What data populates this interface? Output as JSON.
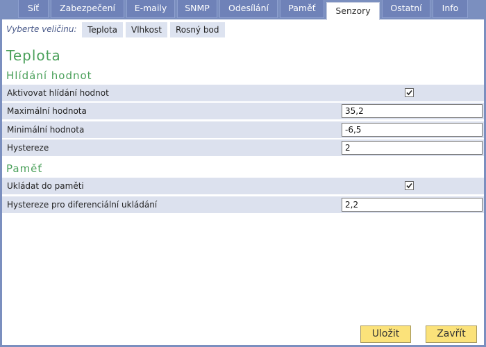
{
  "tabs": [
    {
      "label": "Síť",
      "active": false
    },
    {
      "label": "Zabezpečení",
      "active": false
    },
    {
      "label": "E-maily",
      "active": false
    },
    {
      "label": "SNMP",
      "active": false
    },
    {
      "label": "Odesílání",
      "active": false
    },
    {
      "label": "Paměť",
      "active": false
    },
    {
      "label": "Senzory",
      "active": true
    },
    {
      "label": "Ostatní",
      "active": false
    },
    {
      "label": "Info",
      "active": false
    }
  ],
  "quantity": {
    "label": "Vyberte veličinu:",
    "options": [
      "Teplota",
      "Vlhkost",
      "Rosný bod"
    ]
  },
  "page_title": "Teplota",
  "monitoring": {
    "heading": "Hlídání hodnot",
    "enable_label": "Aktivovat hlídání hodnot",
    "enable_checked": true,
    "max_label": "Maximální hodnota",
    "max_value": "35,2",
    "min_label": "Minimální hodnota",
    "min_value": "-6,5",
    "hysteresis_label": "Hystereze",
    "hysteresis_value": "2"
  },
  "memory": {
    "heading": "Paměť",
    "store_label": "Ukládat do paměti",
    "store_checked": true,
    "diff_label": "Hystereze pro diferenciální ukládání",
    "diff_value": "2,2"
  },
  "buttons": {
    "save": "Uložit",
    "close": "Zavřít"
  },
  "colors": {
    "tabbar": "#7b8fbf",
    "heading": "#4aa05a",
    "row": "#dce1ee",
    "button": "#fbe27a"
  }
}
